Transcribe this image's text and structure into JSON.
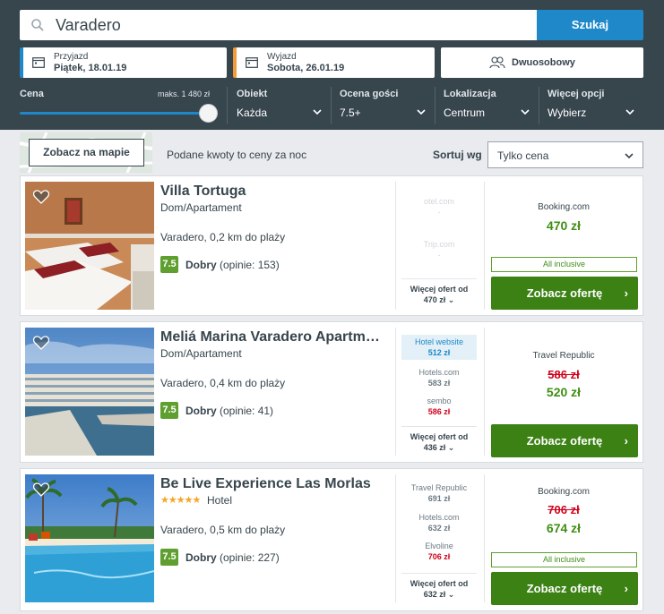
{
  "search": {
    "value": "Varadero",
    "button": "Szukaj"
  },
  "dates": {
    "checkin": {
      "label": "Przyjazd",
      "value": "Piątek, 18.01.19"
    },
    "checkout": {
      "label": "Wyjazd",
      "value": "Sobota, 26.01.19"
    }
  },
  "guests": {
    "value": "Dwuosobowy"
  },
  "filters": {
    "price": {
      "title": "Cena",
      "max_label": "maks. 1 480 zł",
      "slider_level": 1.0
    },
    "object": {
      "title": "Obiekt",
      "value": "Każda"
    },
    "rating": {
      "title": "Ocena gości",
      "value": "7.5+"
    },
    "location": {
      "title": "Lokalizacja",
      "value": "Centrum"
    },
    "more": {
      "title": "Więcej opcji",
      "value": "Wybierz"
    }
  },
  "toolbar": {
    "map_button": "Zobacz na mapie",
    "price_note": "Podane kwoty to ceny za noc",
    "sort_label": "Sortuj wg",
    "sort_value": "Tylko cena"
  },
  "colors": {
    "header": "#37454d",
    "accent": "#1e88c9",
    "cta": "#3c8114",
    "rating": "#5f9f2f",
    "old_price": "#d0021b"
  },
  "hotels": [
    {
      "name": "Villa Tortuga",
      "type": "Dom/Apartament",
      "location": "Varadero, 0,2 km do plaży",
      "rating": "7.5",
      "rating_word": "Dobry",
      "reviews": "(opinie: 153)",
      "offers": [
        {
          "site": "otel.com",
          "price": "-"
        },
        {
          "site": "Trip.com",
          "price": "-"
        }
      ],
      "more_label": "Więcej ofert od",
      "more_price": "470 zł",
      "best_site": "Booking.com",
      "best_price": "470 zł",
      "badge": "All inclusive",
      "cta": "Zobacz ofertę"
    },
    {
      "name": "Meliá Marina Varadero Apartments",
      "type": "Dom/Apartament",
      "location": "Varadero, 0,4 km do plaży",
      "rating": "7.5",
      "rating_word": "Dobry",
      "reviews": "(opinie: 41)",
      "offers": [
        {
          "site": "Hotel website",
          "price": "512 zł"
        },
        {
          "site": "Hotels.com",
          "price": "583 zł"
        },
        {
          "site": "sembo",
          "price": "586 zł"
        }
      ],
      "more_label": "Więcej ofert od",
      "more_price": "436 zł",
      "best_site": "Travel Republic",
      "old_price": "586 zł",
      "best_price": "520 zł",
      "cta": "Zobacz ofertę"
    },
    {
      "name": "Be Live Experience Las Morlas",
      "stars": "★★★★★",
      "type": "Hotel",
      "location": "Varadero, 0,5 km do plaży",
      "rating": "7.5",
      "rating_word": "Dobry",
      "reviews": "(opinie: 227)",
      "offers": [
        {
          "site": "Travel Republic",
          "price": "691 zł"
        },
        {
          "site": "Hotels.com",
          "price": "632 zł"
        },
        {
          "site": "Elvoline",
          "price": "706 zł"
        }
      ],
      "more_label": "Więcej ofert od",
      "more_price": "632 zł",
      "best_site": "Booking.com",
      "old_price": "706 zł",
      "best_price": "674 zł",
      "badge": "All inclusive",
      "cta": "Zobacz ofertę"
    }
  ]
}
